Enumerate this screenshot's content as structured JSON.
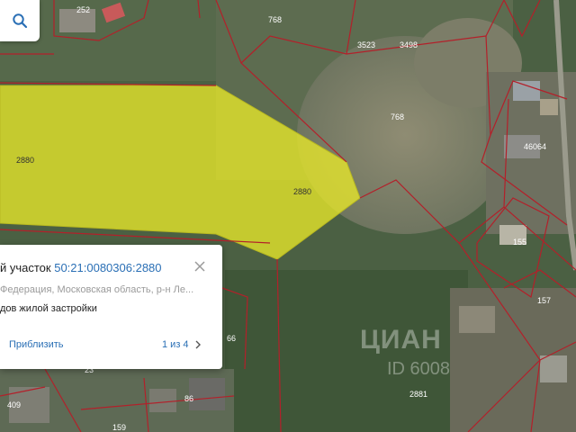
{
  "parcels": {
    "selected": {
      "label": "2880",
      "label2": "2880"
    },
    "labels": {
      "p252": "252",
      "p768a": "768",
      "p3523": "3523",
      "p3498": "3498",
      "p768b": "768",
      "p46064": "46064",
      "p155": "155",
      "p157": "157",
      "p2881": "2881",
      "p409": "409",
      "p86": "86",
      "p159": "159",
      "p23": "23",
      "p66": "66"
    }
  },
  "colors": {
    "selected_fill": "#e8e82a",
    "boundary": "#b3202a"
  },
  "search": {
    "icon": "search-icon"
  },
  "card": {
    "title_prefix": "й участок ",
    "cadastral_number": "50:21:0080306:2880",
    "address": "Федерация, Московская область, р-н Ле...",
    "usage": "дов жилой застройки",
    "zoom_label": "Приблизить",
    "pager_text": "1 из 4"
  },
  "watermark": {
    "brand": "ЦИАН",
    "id": "ID 6008"
  }
}
